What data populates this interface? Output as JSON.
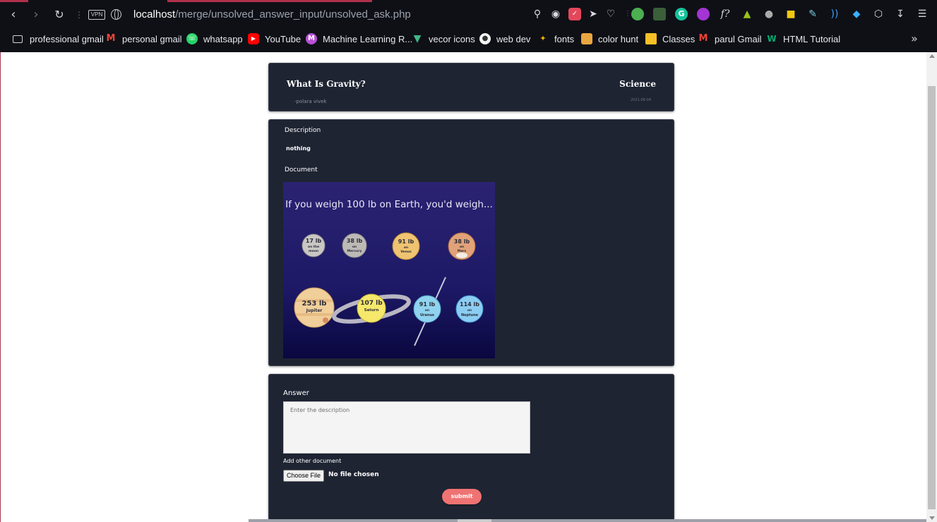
{
  "browser": {
    "url_host": "localhost",
    "url_path": "/merge/unsolved_answer_input/unsolved_ask.php",
    "vpn_label": "VPN",
    "bookmarks": [
      {
        "label": "professional gmail",
        "icon": "folder-icon"
      },
      {
        "label": "personal gmail",
        "icon": "gmail-icon",
        "color": "#ea4335"
      },
      {
        "label": "whatsapp",
        "icon": "whatsapp-icon",
        "color": "#25d366"
      },
      {
        "label": "YouTube",
        "icon": "youtube-icon",
        "color": "#ff0000"
      },
      {
        "label": "Machine Learning R...",
        "icon": "m-icon",
        "color": "#b84fd6"
      },
      {
        "label": "vecor icons",
        "icon": "vue-icon",
        "color": "#41b883"
      },
      {
        "label": "web dev",
        "icon": "webdev-icon",
        "color": "#f5f5f5"
      },
      {
        "label": "fonts",
        "icon": "fonts-icon",
        "color": "#f4b400"
      },
      {
        "label": "color hunt",
        "icon": "colorhunt-icon",
        "color": "#e9a640"
      },
      {
        "label": "Classes",
        "icon": "classroom-icon",
        "color": "#f6c026"
      },
      {
        "label": "parul Gmail",
        "icon": "gmail-icon",
        "color": "#ea4335"
      },
      {
        "label": "HTML Tutorial",
        "icon": "w3-icon",
        "color": "#04aa6d"
      }
    ],
    "more_label": "»"
  },
  "question": {
    "title": "What Is Gravity?",
    "subject": "Science",
    "author": "-polara vivek",
    "date": "2021-06-04"
  },
  "details": {
    "description_label": "Description",
    "description_value": "nothing",
    "document_label": "Document",
    "image": {
      "headline": "If you weigh 100 lb on Earth, you'd weigh...",
      "planets": [
        {
          "weight": "17 lb",
          "on": "on the",
          "name": "moon"
        },
        {
          "weight": "38 lb",
          "on": "on",
          "name": "Mercury"
        },
        {
          "weight": "91 lb",
          "on": "on",
          "name": "Venus"
        },
        {
          "weight": "38 lb",
          "on": "on",
          "name": "Mars"
        },
        {
          "weight": "253 lb",
          "on": "on",
          "name": "Jupiter"
        },
        {
          "weight": "107 lb",
          "on": "on",
          "name": "Saturn"
        },
        {
          "weight": "91 lb",
          "on": "on",
          "name": "Uranus"
        },
        {
          "weight": "114 lb",
          "on": "on",
          "name": "Neptune"
        }
      ]
    }
  },
  "answer": {
    "label": "Answer",
    "placeholder": "Enter the description",
    "add_document_label": "Add other document",
    "choose_file_label": "Choose File",
    "no_file_label": "No file chosen",
    "submit_label": "submit"
  },
  "colors": {
    "card_bg": "#1f2433",
    "submit": "#ef7373",
    "chrome_bg": "#0e1016"
  }
}
